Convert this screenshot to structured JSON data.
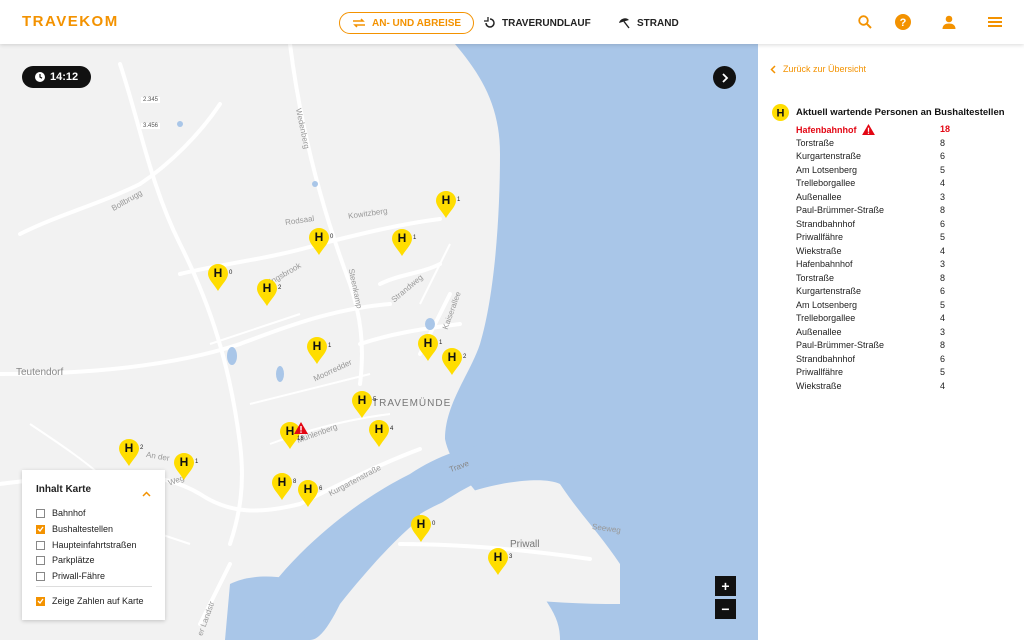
{
  "header": {
    "logo": "TRAVEKOM",
    "nav": [
      {
        "label": "AN- UND ABREISE",
        "icon": "swap-arrows-icon",
        "active": true
      },
      {
        "label": "TRAVERUNDLAUF",
        "icon": "rotate-icon",
        "active": false
      },
      {
        "label": "STRAND",
        "icon": "beach-umbrella-icon",
        "active": false
      }
    ],
    "accent_color": "#f39200"
  },
  "map": {
    "clock": "14:12",
    "place_labels": {
      "teutendorf": "Teutendorf",
      "travemuende": "TRAVEMÜNDE",
      "priwall": "Priwall",
      "bollbrugg": "Bollbrugg",
      "rodsaal": "Rodsaal",
      "kowitzberg": "Kowitzberg",
      "wedenberg": "Wedenberg",
      "steenkamp": "Steenkamp",
      "strandweg": "Strandweg",
      "kaiserallee": "Kaiserallee",
      "moorredder": "Moorredder",
      "muehlenberg": "Mühlenberg",
      "kurgartenstrasse": "Kurgartenstraße",
      "trave": "Trave",
      "seeweg": "Seeweg",
      "an_der": "An der",
      "weg": "Weg",
      "landstr": "er Landstr",
      "road_2345": "2.345",
      "road_3456": "3.456",
      "ingsbrook": "ingsbrook"
    },
    "stops": [
      {
        "count": "1"
      },
      {
        "count": "0"
      },
      {
        "count": "1"
      },
      {
        "count": "0"
      },
      {
        "count": "2"
      },
      {
        "count": "1"
      },
      {
        "count": "1"
      },
      {
        "count": "2"
      },
      {
        "count": "5"
      },
      {
        "count": "4"
      },
      {
        "count": "18",
        "alert": true
      },
      {
        "count": "2"
      },
      {
        "count": "1"
      },
      {
        "count": "8"
      },
      {
        "count": "6"
      },
      {
        "count": "0"
      },
      {
        "count": "3"
      }
    ],
    "zoom_in": "+",
    "zoom_out": "−"
  },
  "legend": {
    "title": "Inhalt Karte",
    "items": [
      {
        "label": "Bahnhof",
        "checked": false
      },
      {
        "label": "Bushaltestellen",
        "checked": true
      },
      {
        "label": "Haupteinfahrtstraßen",
        "checked": false
      },
      {
        "label": "Parkplätze",
        "checked": false
      },
      {
        "label": "Priwall-Fähre",
        "checked": false
      }
    ],
    "show_numbers": {
      "label": "Zeige Zahlen auf Karte",
      "checked": true
    }
  },
  "panel": {
    "back_label": "Zurück zur Übersicht",
    "title": "Aktuell wartende Personen an Bushaltestellen",
    "stops": [
      {
        "name": "Hafenbahnhof",
        "count": "18",
        "alert": true
      },
      {
        "name": "Torstraße",
        "count": "8"
      },
      {
        "name": "Kurgartenstraße",
        "count": "6"
      },
      {
        "name": "Am Lotsenberg",
        "count": "5"
      },
      {
        "name": "Trelleborgallee",
        "count": "4"
      },
      {
        "name": "Außenallee",
        "count": "3"
      },
      {
        "name": "Paul-Brümmer-Straße",
        "count": "8"
      },
      {
        "name": "Strandbahnhof",
        "count": "6"
      },
      {
        "name": "Priwallfähre",
        "count": "5"
      },
      {
        "name": "Wiekstraße",
        "count": "4"
      },
      {
        "name": "Hafenbahnhof",
        "count": "3"
      },
      {
        "name": "Torstraße",
        "count": "8"
      },
      {
        "name": "Kurgartenstraße",
        "count": "6"
      },
      {
        "name": "Am Lotsenberg",
        "count": "5"
      },
      {
        "name": "Trelleborgallee",
        "count": "4"
      },
      {
        "name": "Außenallee",
        "count": "3"
      },
      {
        "name": "Paul-Brümmer-Straße",
        "count": "8"
      },
      {
        "name": "Strandbahnhof",
        "count": "6"
      },
      {
        "name": "Priwallfähre",
        "count": "5"
      },
      {
        "name": "Wiekstraße",
        "count": "4"
      }
    ]
  }
}
